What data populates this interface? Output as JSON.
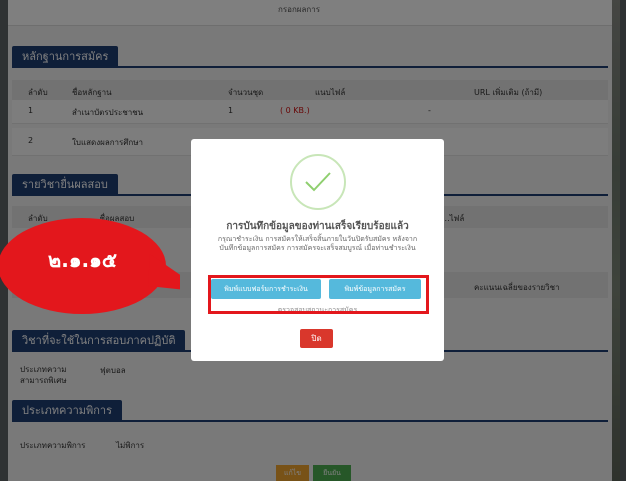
{
  "header_partial": "กรอกผลการ",
  "evidence": {
    "title": "หลักฐานการสมัคร",
    "columns": [
      "ลำดับ",
      "ชื่อหลักฐาน",
      "จำนวนชุด",
      "แนบไฟล์",
      "URL เพิ่มเติม (ถ้ามี)"
    ],
    "rows": [
      {
        "no": "1",
        "name": "สำเนาบัตรประชาชน",
        "count": "1",
        "file": "( 0 KB.)",
        "url": "-"
      },
      {
        "no": "2",
        "name": "ใบแสดงผลการศึกษา",
        "count": "",
        "file": "",
        "url": ""
      }
    ]
  },
  "subjects": {
    "title": "รายวิชายื่นผลสอบ",
    "cols_partial": [
      "ลำดับ",
      "...ชื่อผลสอบ",
      "...ไฟล์"
    ],
    "avg_label": "คะแนนเฉลี่ยของรายวิชา"
  },
  "practical": {
    "title": "วิชาที่จะใช้ในการสอบภาคปฏิบัติ",
    "label": "ประเภทความสามารถพิเศษ",
    "value": "ฟุตบอล"
  },
  "disability": {
    "title": "ประเภทความพิการ",
    "label": "ประเภทความพิการ",
    "value": "ไม่พิการ"
  },
  "footer_buttons": {
    "edit": "แก้ไข",
    "confirm": "ยืนยัน"
  },
  "modal": {
    "title": "การบันทึกข้อมูลของท่านเสร็จเรียบร้อยแล้ว",
    "message": "กรุณาชำระเงิน การสมัครให้เสร็จสิ้นภายในวันปิดรับสมัคร หลังจากบันทึกข้อมูลการสมัคร การสมัครจะเสร็จสมบูรณ์ เมื่อท่านชำระเงิน",
    "print_payment_button": "พิมพ์แบบฟอร์มการชำระเงิน",
    "print_application_button": "พิมพ์ข้อมูลการสมัคร",
    "under_text": "ตรวจสอบสถานะการสมัคร",
    "close_button": "ปิด"
  },
  "callout": {
    "text": "๒.๑.๑๕",
    "color": "#e3171c"
  }
}
